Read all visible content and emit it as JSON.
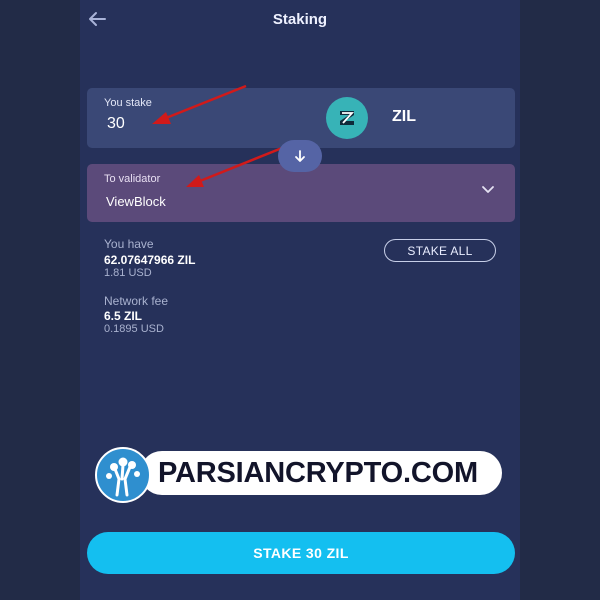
{
  "header": {
    "title": "Staking",
    "back_icon": "arrow-left-icon"
  },
  "stake_input": {
    "label": "You stake",
    "value": "30",
    "token_symbol": "ZIL",
    "token_icon": "zilliqa-logo-icon"
  },
  "swap_icon": "arrow-down-icon",
  "validator": {
    "label": "To validator",
    "value": "ViewBlock",
    "chevron_icon": "chevron-down-icon"
  },
  "balance": {
    "label": "You have",
    "amount": "62.07647966 ZIL",
    "usd": "1.81 USD",
    "stake_all_label": "STAKE ALL"
  },
  "fee": {
    "label": "Network fee",
    "amount": "6.5 ZIL",
    "usd": "0.1895 USD"
  },
  "watermark": {
    "text": "PARSIANCRYPTO.COM"
  },
  "cta": {
    "label": "STAKE 30 ZIL"
  },
  "colors": {
    "background": "#26315a",
    "stake_box": "#3a4876",
    "validator_box": "#5b4a7a",
    "accent": "#14bff0",
    "annotation_arrow": "#d11a1a"
  }
}
